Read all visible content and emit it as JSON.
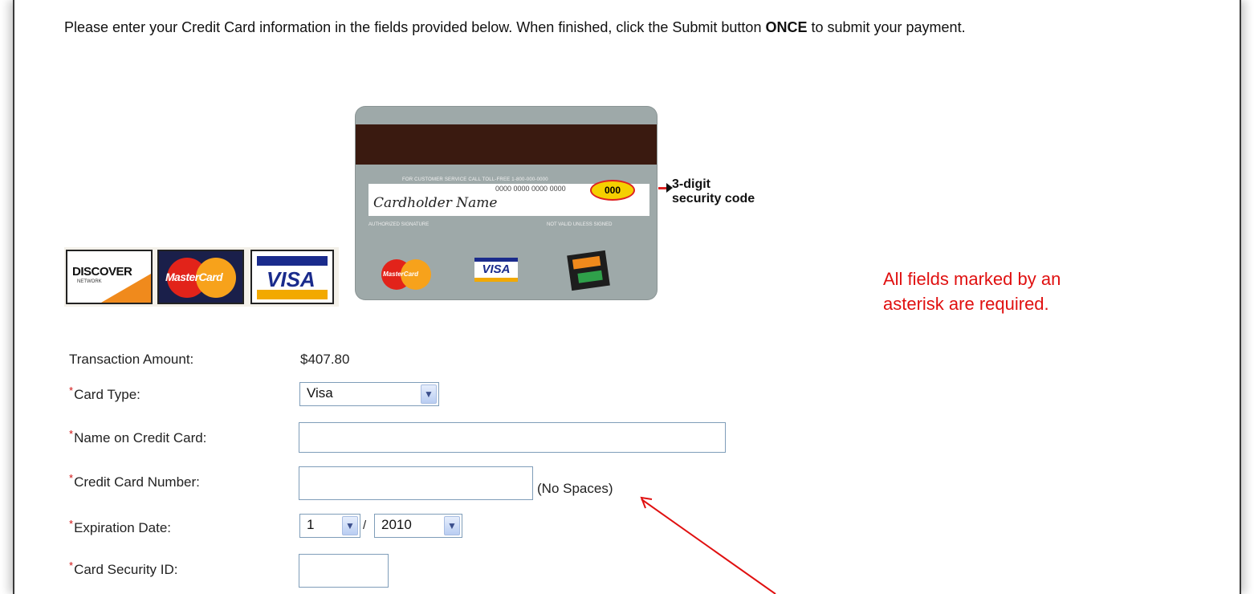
{
  "intro": {
    "part1": "Please enter your Credit Card information in the fields provided below. When finished, click the Submit button ",
    "emphasis": "ONCE",
    "part2": " to submit your payment."
  },
  "logos": {
    "discover": "DISCOVER",
    "discover_sub": "NETWORK",
    "mastercard": "MasterCard",
    "visa": "VISA"
  },
  "card_image": {
    "customer_service": "FOR CUSTOMER SERVICE CALL TOLL-FREE 1-800-000-0000",
    "card_numbers": "0000 0000 0000 0000",
    "security_code": "000",
    "cardholder_name": "Cardholder Name",
    "authorized_signature": "AUTHORIZED SIGNATURE",
    "not_valid": "NOT VALID UNLESS SIGNED",
    "mini_mastercard": "MasterCard",
    "mini_visa": "VISA",
    "security_label": "3-digit security code"
  },
  "required_note": "All fields marked by an asterisk are required.",
  "form": {
    "transaction_amount_label": "Transaction Amount:",
    "transaction_amount_value": "$407.80",
    "card_type_label": "Card Type:",
    "card_type_value": "Visa",
    "name_label": "Name on Credit Card:",
    "name_value": "",
    "number_label": "Credit Card Number:",
    "number_value": "",
    "number_hint": "(No Spaces)",
    "expiration_label": "Expiration Date:",
    "expiration_month": "1",
    "expiration_year": "2010",
    "security_id_label": "Card Security ID:",
    "security_id_value": ""
  },
  "colors": {
    "required_red": "#e01010",
    "annotation_arrow": "#e01010",
    "input_border": "#7f9db9"
  }
}
